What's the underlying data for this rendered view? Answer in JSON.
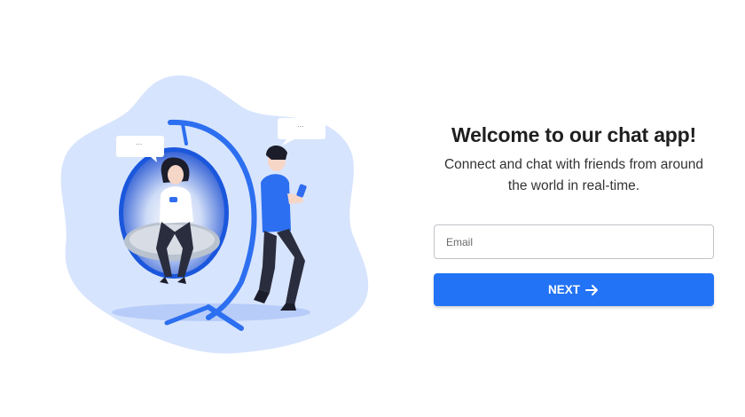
{
  "welcome": {
    "title": "Welcome to our chat app!",
    "subtitle": "Connect and chat with friends from around the world in real-time."
  },
  "form": {
    "email_placeholder": "Email",
    "email_value": "",
    "next_label": "NEXT"
  },
  "illustration": {
    "bubble_left_text": "...",
    "bubble_right_text": "..."
  },
  "colors": {
    "accent": "#2273f5",
    "blob": "#d7e4fd",
    "text_dark": "#1f1f1f"
  },
  "icons": {
    "next": "arrow-right-icon"
  }
}
